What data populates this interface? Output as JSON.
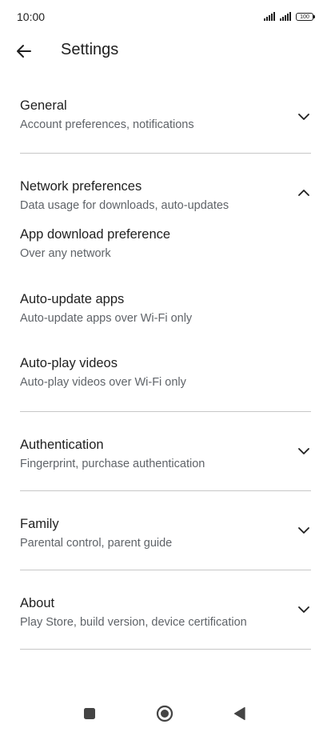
{
  "status_bar": {
    "time": "10:00",
    "battery": "100",
    "icons": [
      "signal-icon",
      "signal-icon",
      "battery-icon"
    ]
  },
  "app_bar": {
    "title": "Settings",
    "back_icon": "arrow-back-icon"
  },
  "sections": {
    "general": {
      "title": "General",
      "subtitle": "Account preferences, notifications",
      "expanded": false
    },
    "network": {
      "title": "Network preferences",
      "subtitle": "Data usage for downloads, auto-updates",
      "expanded": true,
      "items": [
        {
          "title": "App download preference",
          "subtitle": "Over any network"
        },
        {
          "title": "Auto-update apps",
          "subtitle": "Auto-update apps over Wi-Fi only"
        },
        {
          "title": "Auto-play videos",
          "subtitle": "Auto-play videos over Wi-Fi only"
        }
      ]
    },
    "authentication": {
      "title": "Authentication",
      "subtitle": "Fingerprint, purchase authentication",
      "expanded": false
    },
    "family": {
      "title": "Family",
      "subtitle": "Parental control, parent guide",
      "expanded": false
    },
    "about": {
      "title": "About",
      "subtitle": "Play Store, build version, device certification",
      "expanded": false
    }
  },
  "nav_bar": {
    "icons": [
      "recents-square-icon",
      "home-circle-icon",
      "back-triangle-icon"
    ]
  },
  "colors": {
    "text_primary": "#1f1f1f",
    "text_secondary": "#5f6368",
    "divider": "#c7c7c7",
    "background": "#ffffff",
    "nav_icon": "#444444"
  }
}
